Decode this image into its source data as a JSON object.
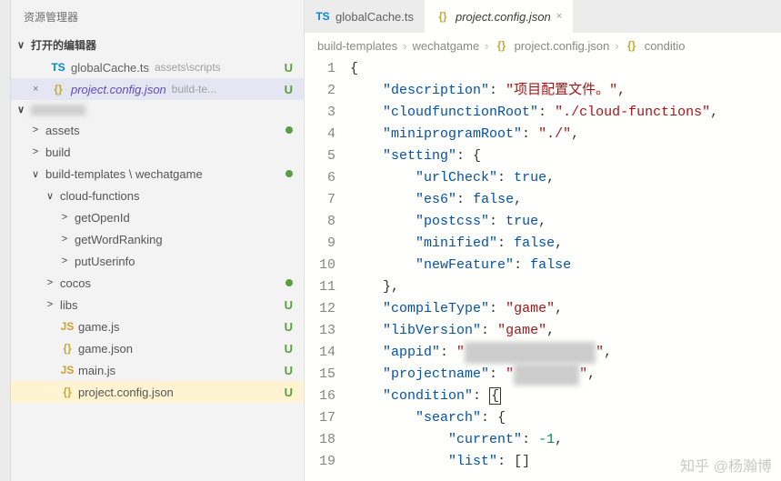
{
  "sidebar": {
    "title": "资源管理器",
    "open_editors_label": "打开的编辑器",
    "open_editors": [
      {
        "icon": "TS",
        "name": "globalCache.ts",
        "dir": "assets\\scripts",
        "status": "U",
        "close": ""
      },
      {
        "icon": "{}",
        "name": "project.config.json",
        "dir": "build-te...",
        "status": "U",
        "close": "×"
      }
    ],
    "tree": [
      {
        "chev": ">",
        "label": "assets",
        "indent": 1,
        "dot": true
      },
      {
        "chev": ">",
        "label": "build",
        "indent": 1
      },
      {
        "chev": "∨",
        "label": "build-templates \\ wechatgame",
        "indent": 1,
        "dot": true
      },
      {
        "chev": "∨",
        "label": "cloud-functions",
        "indent": 2
      },
      {
        "chev": ">",
        "label": "getOpenId",
        "indent": 3
      },
      {
        "chev": ">",
        "label": "getWordRanking",
        "indent": 3
      },
      {
        "chev": ">",
        "label": "putUserinfo",
        "indent": 3
      },
      {
        "chev": ">",
        "label": "cocos",
        "indent": 2,
        "dot": true
      },
      {
        "chev": ">",
        "label": "libs",
        "indent": 2,
        "status": "U"
      },
      {
        "icon": "JS",
        "label": "game.js",
        "indent": 2,
        "status": "U"
      },
      {
        "icon": "{}",
        "label": "game.json",
        "indent": 2,
        "status": "U"
      },
      {
        "icon": "JS",
        "label": "main.js",
        "indent": 2,
        "status": "U"
      },
      {
        "icon": "{}",
        "label": "project.config.json",
        "indent": 2,
        "status": "U",
        "selected": true
      }
    ]
  },
  "tabs": [
    {
      "icon": "TS",
      "name": "globalCache.ts",
      "active": false
    },
    {
      "icon": "{}",
      "name": "project.config.json",
      "active": true
    }
  ],
  "breadcrumb": {
    "parts": [
      "build-templates",
      "wechatgame",
      "project.config.json",
      "conditio"
    ],
    "file_icon": "{}",
    "obj_icon": "{}"
  },
  "code": {
    "lines": [
      1,
      2,
      3,
      4,
      5,
      6,
      7,
      8,
      9,
      10,
      11,
      12,
      13,
      14,
      15,
      16,
      17,
      18,
      19
    ],
    "content": {
      "description_key": "\"description\"",
      "description_val": "\"项目配置文件。\"",
      "cloudfunctionRoot_key": "\"cloudfunctionRoot\"",
      "cloudfunctionRoot_val": "\"./cloud-functions\"",
      "miniprogramRoot_key": "\"miniprogramRoot\"",
      "miniprogramRoot_val": "\"./\"",
      "setting_key": "\"setting\"",
      "urlCheck_key": "\"urlCheck\"",
      "urlCheck_val": "true",
      "es6_key": "\"es6\"",
      "es6_val": "false",
      "postcss_key": "\"postcss\"",
      "postcss_val": "true",
      "minified_key": "\"minified\"",
      "minified_val": "false",
      "newFeature_key": "\"newFeature\"",
      "newFeature_val": "false",
      "compileType_key": "\"compileType\"",
      "compileType_val": "\"game\"",
      "libVersion_key": "\"libVersion\"",
      "libVersion_val": "\"game\"",
      "appid_key": "\"appid\"",
      "appid_val": "\"                \"",
      "projectname_key": "\"projectname\"",
      "projectname_val": "\"        \"",
      "condition_key": "\"condition\"",
      "search_key": "\"search\"",
      "current_key": "\"current\"",
      "current_val": "-1",
      "list_key": "\"list\""
    }
  },
  "watermark": "知乎 @杨瀚博"
}
